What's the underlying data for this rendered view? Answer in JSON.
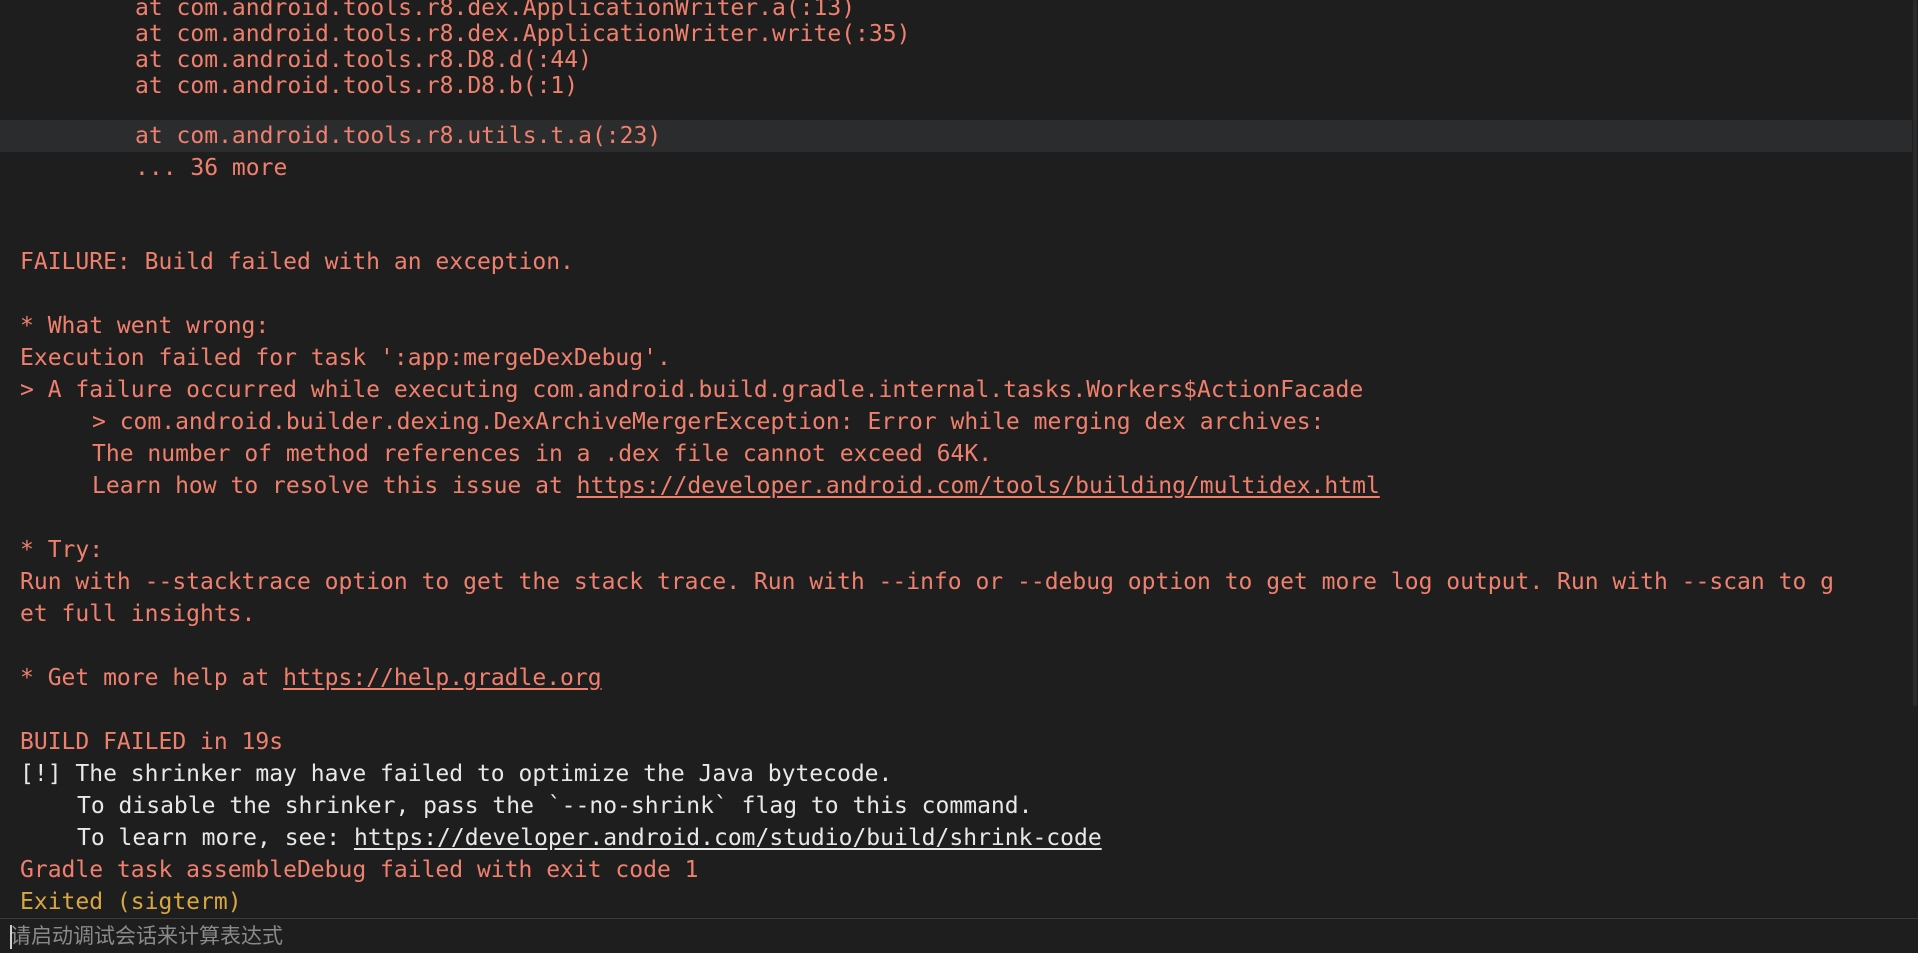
{
  "console": {
    "stack_lines": [
      "at com.android.tools.r8.dex.ApplicationWriter.a(:13)",
      "at com.android.tools.r8.dex.ApplicationWriter.write(:35)",
      "at com.android.tools.r8.D8.d(:44)",
      "at com.android.tools.r8.D8.b(:1)",
      "at com.android.tools.r8.utils.t.a(:23)",
      "... 36 more"
    ],
    "failure_header": "FAILURE: Build failed with an exception.",
    "what_went_wrong_heading": "* What went wrong:",
    "execution_failed": "Execution failed for task ':app:mergeDexDebug'.",
    "failure_occurred": "> A failure occurred while executing com.android.build.gradle.internal.tasks.Workers$ActionFacade",
    "dex_merger_exception": "> com.android.builder.dexing.DexArchiveMergerException: Error while merging dex archives:",
    "method_refs": "The number of method references in a .dex file cannot exceed 64K.",
    "learn_prefix": "Learn how to resolve this issue at ",
    "multidex_link": "https://developer.android.com/tools/building/multidex.html",
    "try_heading": "* Try:",
    "try_line1": "Run with --stacktrace option to get the stack trace. Run with --info or --debug option to get more log output. Run with --scan to g",
    "try_line2": "et full insights.",
    "help_prefix": "* Get more help at ",
    "help_link": "https://help.gradle.org",
    "build_failed": "BUILD FAILED in 19s",
    "shrinker_warning": "[!] The shrinker may have failed to optimize the Java bytecode.",
    "shrinker_disable": "To disable the shrinker, pass the `--no-shrink` flag to this command.",
    "learn_more_prefix": "To learn more, see: ",
    "shrink_link": "https://developer.android.com/studio/build/shrink-code",
    "gradle_task_failed": "Gradle task assembleDebug failed with exit code 1",
    "exited": "Exited (sigterm)"
  },
  "expression_bar": {
    "placeholder": "请启动调试会话来计算表达式"
  },
  "colors": {
    "background": "#1e1e1e",
    "error_text": "#f0806e",
    "normal_text": "#e8e8e8",
    "exit_text": "#d9a740",
    "highlight_row": "#2a2c2e"
  }
}
